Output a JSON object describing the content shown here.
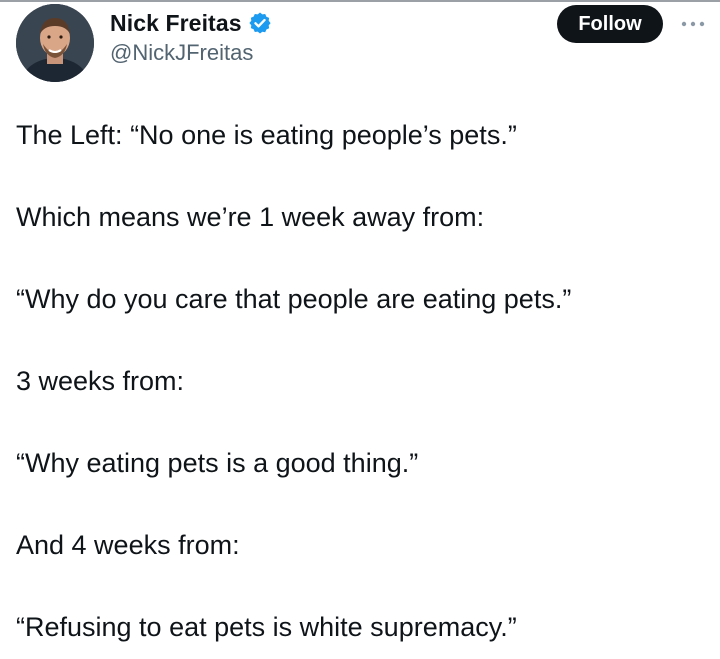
{
  "author": {
    "display_name": "Nick Freitas",
    "handle": "@NickJFreitas",
    "verified": true,
    "avatar_icon": "profile-photo",
    "verified_icon": "verified-badge-icon",
    "verified_color": "#1d9bf0"
  },
  "actions": {
    "follow_label": "Follow",
    "more_icon": "more-options-icon"
  },
  "tweet": {
    "lines": [
      "The Left: “No one is eating people’s pets.”",
      "Which means we’re  1 week away from:",
      "“Why do you care that people are eating pets.”",
      "3 weeks from:",
      "“Why eating pets is a good thing.”",
      "And 4 weeks from:",
      "“Refusing to eat pets is white supremacy.”"
    ]
  },
  "colors": {
    "text": "#0f1419",
    "secondary_text": "#536471",
    "button_bg": "#0f1419",
    "button_text": "#ffffff"
  }
}
